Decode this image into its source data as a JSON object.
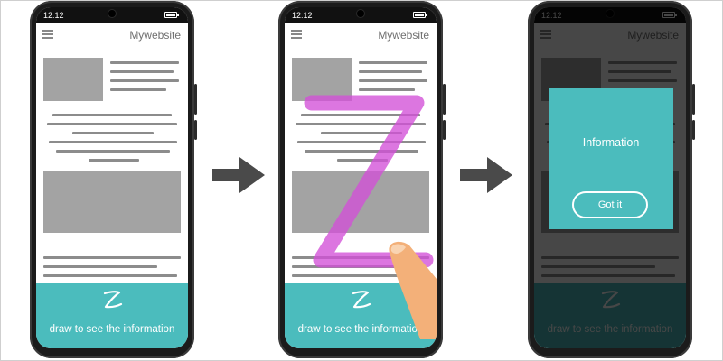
{
  "status": {
    "time": "12:12"
  },
  "site": {
    "title": "Mywebsite"
  },
  "cta": {
    "label": "draw to see the information"
  },
  "modal": {
    "title": "Information",
    "button_label": "Got it"
  },
  "icons": {
    "menu": "hamburger-menu-icon",
    "battery": "battery-icon",
    "gesture": "z-gesture-icon",
    "arrow": "right-arrow-icon"
  },
  "colors": {
    "accent": "#4bbcbd",
    "gesture": "#d24fd7",
    "placeholder": "#a3a3a3",
    "overlay": "#000000"
  }
}
